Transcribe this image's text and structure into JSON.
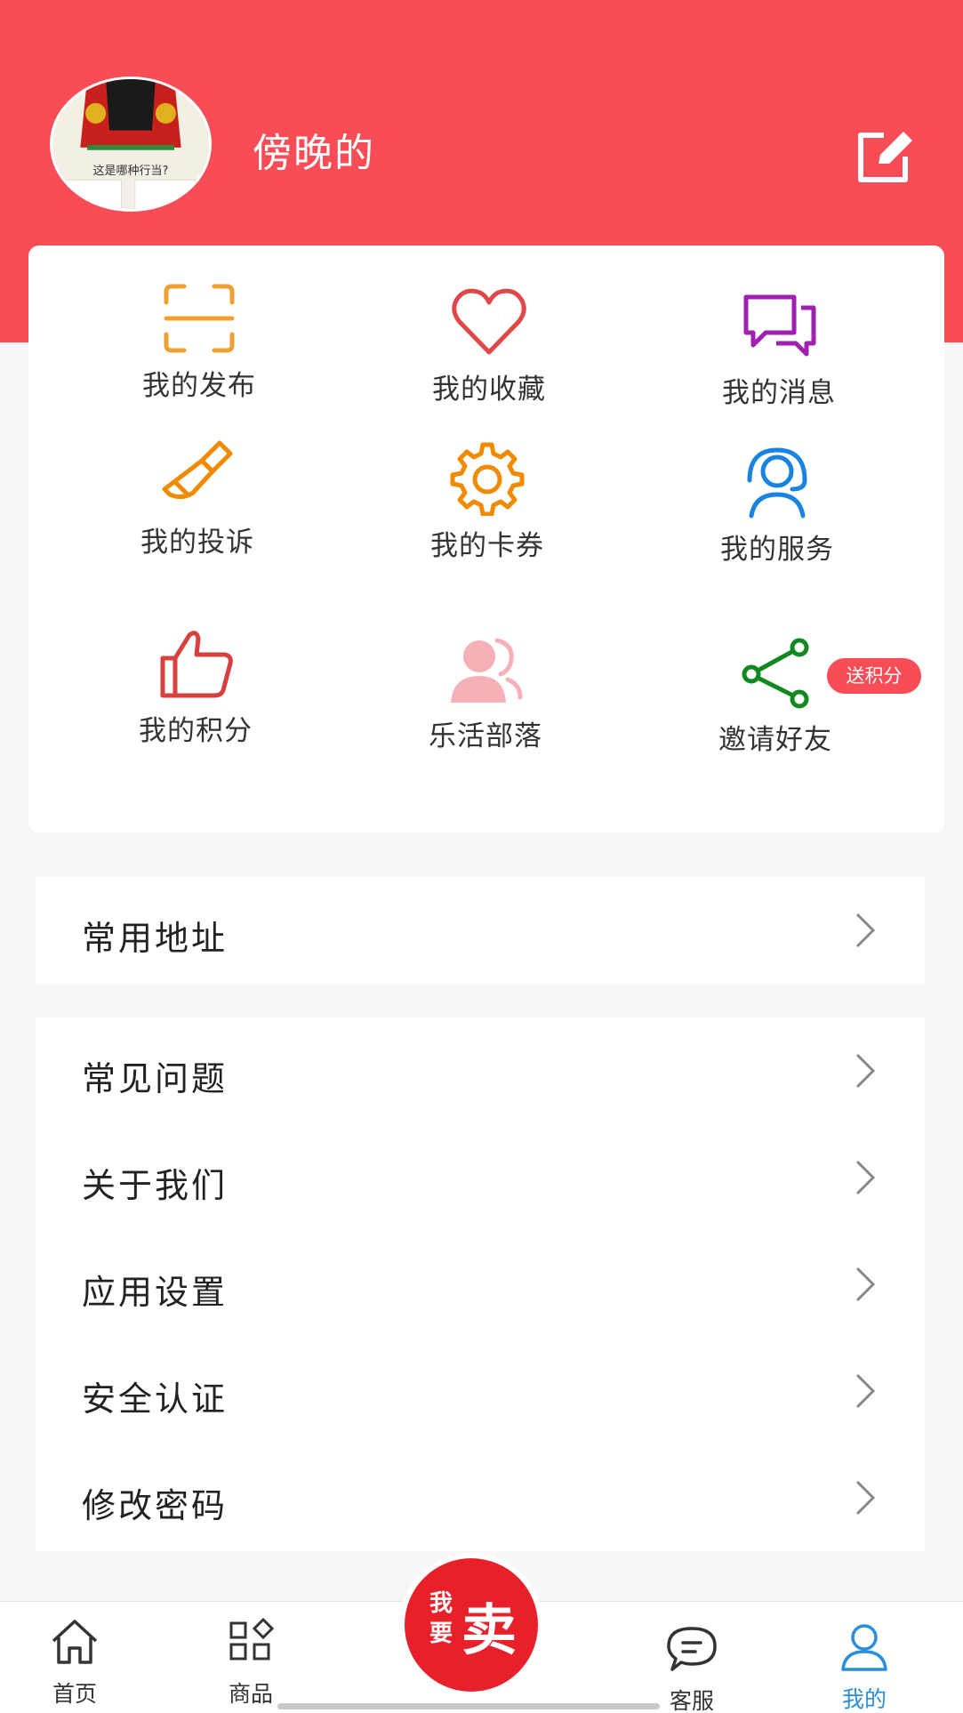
{
  "header": {
    "username": "傍晚的",
    "avatar_caption": "这是哪种行当?",
    "edit_icon": "edit-icon",
    "background_color": "#f84c56"
  },
  "grid": {
    "items": [
      {
        "label": "我的发布",
        "icon": "scan-frame-icon",
        "color": "#f0a030"
      },
      {
        "label": "我的收藏",
        "icon": "heart-icon",
        "color": "#e04848"
      },
      {
        "label": "我的消息",
        "icon": "chat-bubbles-icon",
        "color": "#a020b0"
      },
      {
        "label": "我的投诉",
        "icon": "brush-icon",
        "color": "#f08a00"
      },
      {
        "label": "我的卡券",
        "icon": "gear-icon",
        "color": "#f08a00"
      },
      {
        "label": "我的服务",
        "icon": "headset-user-icon",
        "color": "#1a82e0"
      },
      {
        "label": "我的积分",
        "icon": "thumbs-up-icon",
        "color": "#d84040"
      },
      {
        "label": "乐活部落",
        "icon": "people-icon",
        "color": "#f5b0b8"
      },
      {
        "label": "邀请好友",
        "icon": "share-icon",
        "color": "#108a20"
      }
    ],
    "invite_badge": "送积分"
  },
  "menu": {
    "group1": [
      {
        "label": "常用地址"
      }
    ],
    "group2": [
      {
        "label": "常见问题"
      },
      {
        "label": "关于我们"
      },
      {
        "label": "应用设置"
      },
      {
        "label": "安全认证"
      },
      {
        "label": "修改密码"
      }
    ]
  },
  "tabbar": {
    "tabs": [
      {
        "label": "首页",
        "icon": "home-icon"
      },
      {
        "label": "商品",
        "icon": "category-icon"
      },
      {
        "label": "客服",
        "icon": "chat-icon"
      },
      {
        "label": "我的",
        "icon": "user-icon",
        "active": true
      }
    ],
    "sell_button": {
      "small": "我要",
      "big": "卖"
    },
    "active_color": "#2a8fd8"
  }
}
